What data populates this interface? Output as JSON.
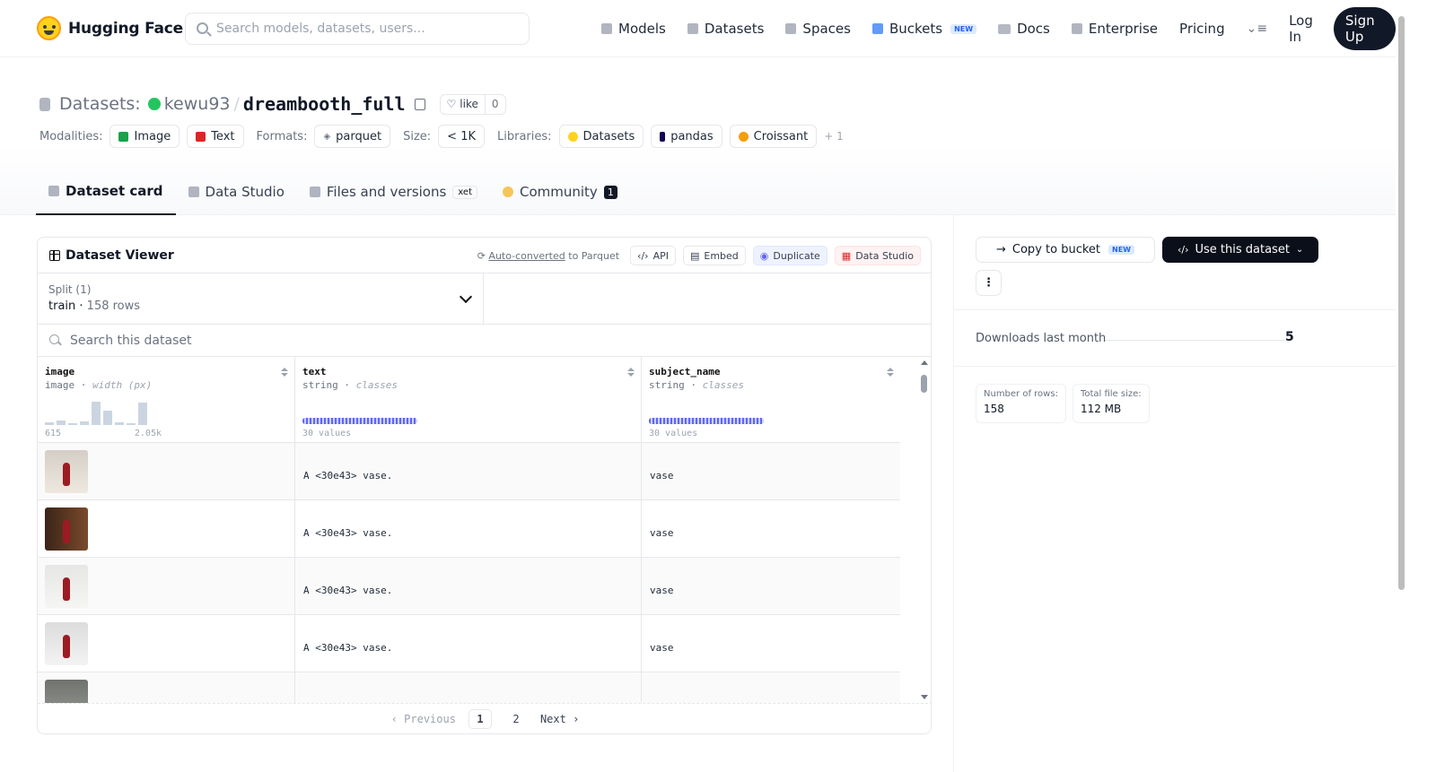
{
  "nav": {
    "brand": "Hugging Face",
    "search_placeholder": "Search models, datasets, users...",
    "links": [
      "Models",
      "Datasets",
      "Spaces",
      "Buckets",
      "Docs",
      "Enterprise",
      "Pricing"
    ],
    "buckets_badge": "NEW",
    "login": "Log In",
    "signup": "Sign Up"
  },
  "header": {
    "prefix": "Datasets:",
    "owner": "kewu93",
    "dataset": "dreambooth_full",
    "like_label": "like",
    "like_count": "0",
    "modalities_label": "Modalities:",
    "modalities": [
      "Image",
      "Text"
    ],
    "formats_label": "Formats:",
    "format": "parquet",
    "size_label": "Size:",
    "size": "< 1K",
    "libraries_label": "Libraries:",
    "libraries": [
      "Datasets",
      "pandas",
      "Croissant"
    ],
    "libraries_more": "+ 1",
    "tabs": [
      "Dataset card",
      "Data Studio",
      "Files and versions",
      "Community"
    ],
    "xet_badge": "xet",
    "community_count": "1"
  },
  "viewer": {
    "title": "Dataset Viewer",
    "auto_converted": "Auto-converted",
    "to_parquet": "to Parquet",
    "api": "API",
    "embed": "Embed",
    "duplicate": "Duplicate",
    "data_studio": "Data Studio",
    "split_label": "Split (1)",
    "split_name": "train",
    "split_rows": "158 rows",
    "search_placeholder": "Search this dataset",
    "columns": [
      {
        "name": "image",
        "type": "image",
        "extra": "width (px)",
        "min": "615",
        "max": "2.05k"
      },
      {
        "name": "text",
        "type": "string",
        "extra": "classes",
        "values": "30 values"
      },
      {
        "name": "subject_name",
        "type": "string",
        "extra": "classes",
        "values": "30 values"
      }
    ],
    "histogram": [
      0.1,
      0.2,
      0.05,
      0.15,
      1.0,
      0.6,
      0.1,
      0.0,
      0.95
    ],
    "rows": [
      {
        "text": "A <30e43> vase.",
        "subject": "vase"
      },
      {
        "text": "A <30e43> vase.",
        "subject": "vase"
      },
      {
        "text": "A <30e43> vase.",
        "subject": "vase"
      },
      {
        "text": "A <30e43> vase.",
        "subject": "vase"
      }
    ],
    "pager": {
      "prev": "Previous",
      "pages": [
        "1",
        "2"
      ],
      "next": "Next"
    }
  },
  "sidebar": {
    "copy_bucket": "Copy to bucket",
    "copy_badge": "NEW",
    "use_dataset": "Use this dataset",
    "more": "⋮",
    "downloads_label": "Downloads last month",
    "downloads_value": "5",
    "rows_label": "Number of rows:",
    "rows_value": "158",
    "size_label": "Total file size:",
    "size_value": "112 MB"
  },
  "colors": {
    "brand_yellow": "#ffd21e",
    "dark": "#111827",
    "accent_indigo": "#6366f1"
  }
}
